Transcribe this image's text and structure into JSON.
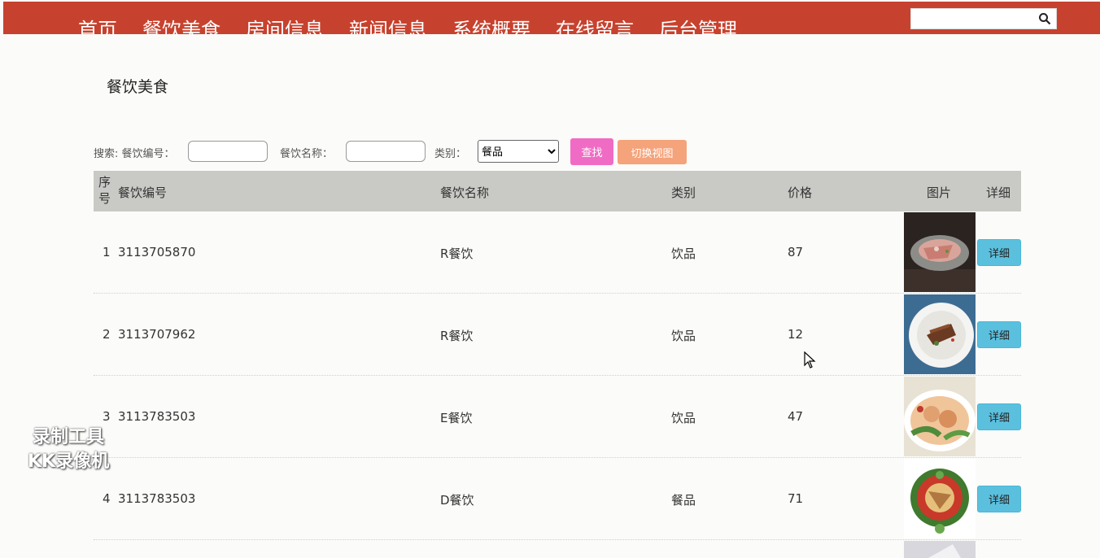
{
  "nav": {
    "items": [
      "首页",
      "餐饮美食",
      "房间信息",
      "新闻信息",
      "系统概要",
      "在线留言",
      "后台管理"
    ]
  },
  "search": {
    "value": ""
  },
  "page": {
    "title": "餐饮美食"
  },
  "filter": {
    "search_label": "搜索: 餐饮编号：",
    "name_label": "餐饮名称：",
    "category_label": "类别：",
    "category_selected": "餐品",
    "find_button": "查找",
    "view_button": "切换视图"
  },
  "table": {
    "headers": {
      "index": "序号",
      "code": "餐饮编号",
      "name": "餐饮名称",
      "category": "类别",
      "price": "价格",
      "image": "图片",
      "detail": "详细"
    },
    "detail_label": "详细",
    "rows": [
      {
        "index": "1",
        "code": "3113705870",
        "name": "R餐饮",
        "category": "饮品",
        "price": "87"
      },
      {
        "index": "2",
        "code": "3113707962",
        "name": "R餐饮",
        "category": "饮品",
        "price": "12"
      },
      {
        "index": "3",
        "code": "3113783503",
        "name": "E餐饮",
        "category": "饮品",
        "price": "47"
      },
      {
        "index": "4",
        "code": "3113783503",
        "name": "D餐饮",
        "category": "餐品",
        "price": "71"
      }
    ]
  },
  "watermark": {
    "line1": "录制工具",
    "line2": "KK录像机"
  },
  "colors": {
    "header_bg": "#c7422e",
    "find_btn": "#f06cc4",
    "view_btn": "#f5a37a",
    "detail_btn": "#5bc0de"
  }
}
